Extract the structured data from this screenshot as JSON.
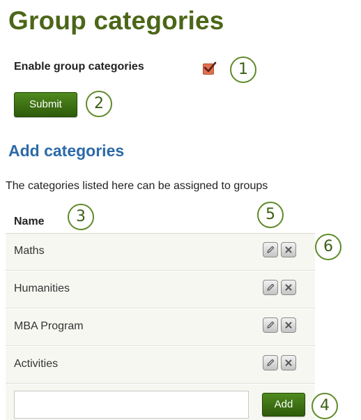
{
  "page_title": "Group categories",
  "settings": {
    "enable_label": "Enable group categories",
    "enable_checked": true,
    "submit_label": "Submit"
  },
  "categories_section": {
    "heading": "Add categories",
    "description": "The categories listed here can be assigned to groups",
    "column_header": "Name",
    "rows": [
      {
        "name": "Maths"
      },
      {
        "name": "Humanities"
      },
      {
        "name": "MBA Program"
      },
      {
        "name": "Activities"
      }
    ],
    "new_category_value": "",
    "add_label": "Add"
  },
  "callouts": [
    "1",
    "2",
    "3",
    "4",
    "5",
    "6"
  ],
  "colors": {
    "title": "#4c6618",
    "heading": "#2c6aa8",
    "button": "#3a6e12",
    "checkbox": "#e07050",
    "callout_border": "#5f8a2a"
  }
}
